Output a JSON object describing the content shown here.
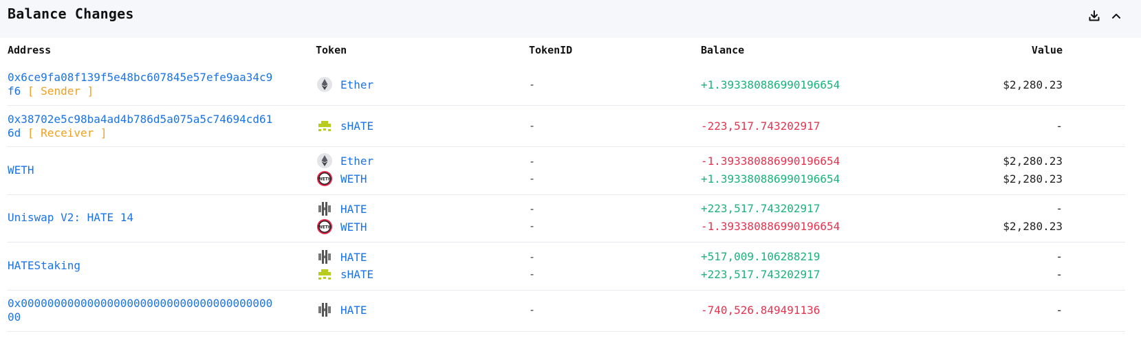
{
  "title": "Balance Changes",
  "columns": {
    "address": "Address",
    "token": "Token",
    "token_id": "TokenID",
    "balance": "Balance",
    "value": "Value"
  },
  "rows": [
    {
      "address_line1": "0x6ce9fa08f139f5e48bc607845e57efe9aa34c9",
      "address_line2": "f6",
      "role": "[ Sender ]",
      "entries": [
        {
          "token": "Ether",
          "icon": "ether-icon",
          "token_id": "-",
          "balance": "+1.393380886990196654",
          "value": "$2,280.23"
        }
      ]
    },
    {
      "address_line1": "0x38702e5c98ba4ad4b786d5a075a5c74694cd61",
      "address_line2": "6d",
      "role": "[ Receiver ]",
      "entries": [
        {
          "token": "sHATE",
          "icon": "shate-icon",
          "token_id": "-",
          "balance": "-223,517.743202917",
          "value": "-"
        }
      ]
    },
    {
      "address_line1": "WETH",
      "entries": [
        {
          "token": "Ether",
          "icon": "ether-icon",
          "token_id": "-",
          "balance": "-1.393380886990196654",
          "value": "$2,280.23"
        },
        {
          "token": "WETH",
          "icon": "weth-icon",
          "token_id": "-",
          "balance": "+1.393380886990196654",
          "value": "$2,280.23"
        }
      ]
    },
    {
      "address_line1": "Uniswap V2: HATE 14",
      "entries": [
        {
          "token": "HATE",
          "icon": "hate-icon",
          "token_id": "-",
          "balance": "+223,517.743202917",
          "value": "-"
        },
        {
          "token": "WETH",
          "icon": "weth-icon",
          "token_id": "-",
          "balance": "-1.393380886990196654",
          "value": "$2,280.23"
        }
      ]
    },
    {
      "address_line1": "HATEStaking",
      "entries": [
        {
          "token": "HATE",
          "icon": "hate-icon",
          "token_id": "-",
          "balance": "+517,009.106288219",
          "value": "-"
        },
        {
          "token": "sHATE",
          "icon": "shate-icon",
          "token_id": "-",
          "balance": "+223,517.743202917",
          "value": "-"
        }
      ]
    },
    {
      "address_line1": "0x00000000000000000000000000000000000000",
      "address_line2": "00",
      "entries": [
        {
          "token": "HATE",
          "icon": "hate-icon",
          "token_id": "-",
          "balance": "-740,526.849491136",
          "value": "-"
        }
      ]
    }
  ]
}
